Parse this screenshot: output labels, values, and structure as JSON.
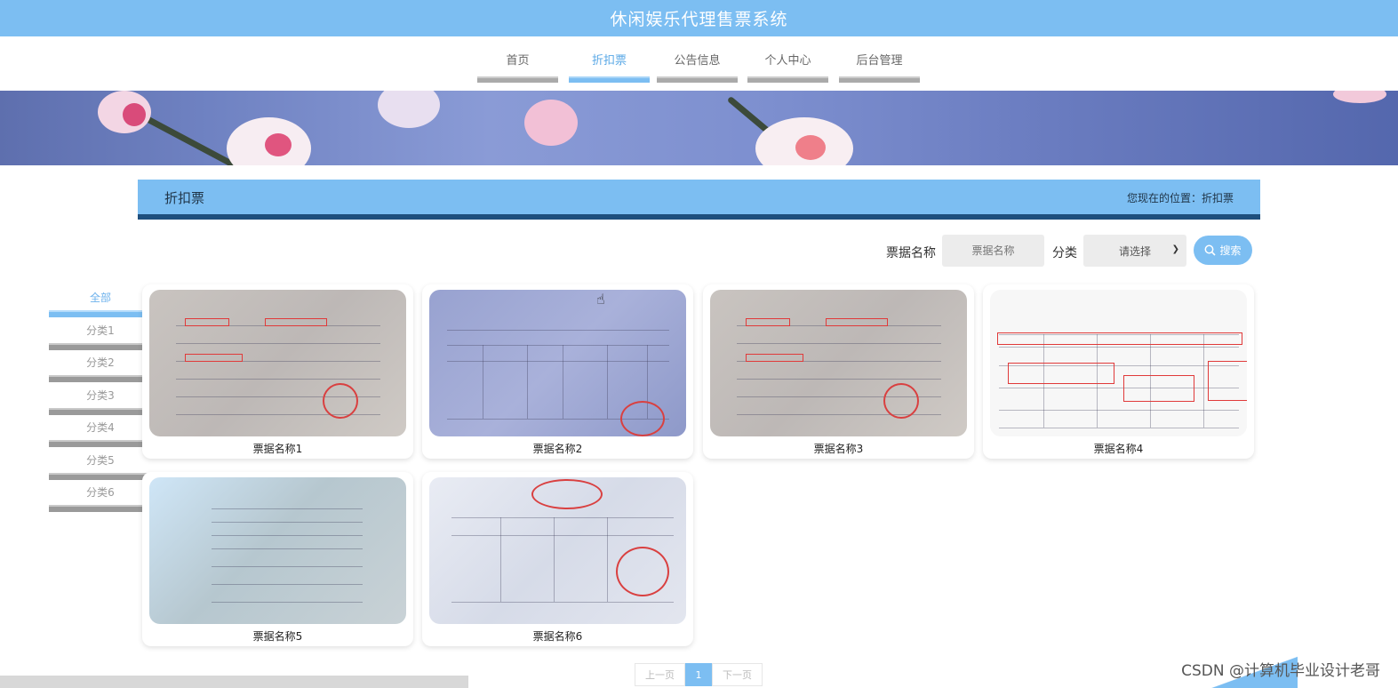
{
  "app": {
    "title": "休闲娱乐代理售票系统"
  },
  "nav": {
    "items": [
      {
        "label": "首页"
      },
      {
        "label": "折扣票"
      },
      {
        "label": "公告信息"
      },
      {
        "label": "个人中心"
      },
      {
        "label": "后台管理"
      }
    ],
    "active": "折扣票"
  },
  "section": {
    "title": "折扣票",
    "location": "您现在的位置：折扣票"
  },
  "search": {
    "name_label": "票据名称",
    "name_placeholder": "票据名称",
    "category_label": "分类",
    "category_selected": "请选择",
    "button_label": "搜索"
  },
  "categories": {
    "items": [
      {
        "label": "全部"
      },
      {
        "label": "分类1"
      },
      {
        "label": "分类2"
      },
      {
        "label": "分类3"
      },
      {
        "label": "分类4"
      },
      {
        "label": "分类5"
      },
      {
        "label": "分类6"
      }
    ],
    "active": "全部"
  },
  "tickets": [
    {
      "name": "票据名称1"
    },
    {
      "name": "票据名称2"
    },
    {
      "name": "票据名称3"
    },
    {
      "name": "票据名称4"
    },
    {
      "name": "票据名称5"
    },
    {
      "name": "票据名称6"
    }
  ],
  "pager": {
    "prev": "上一页",
    "current": "1",
    "next": "下一页"
  },
  "watermark": "CSDN @计算机毕业设计老哥",
  "colors": {
    "accent": "#7cbef2",
    "dark": "#1e4f7d"
  }
}
